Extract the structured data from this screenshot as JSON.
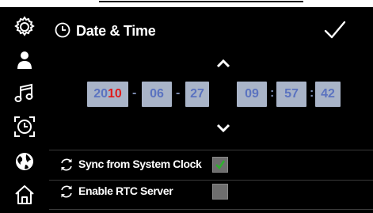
{
  "header": {
    "title": "Date & Time"
  },
  "sidebar": {
    "items": [
      {
        "name": "settings",
        "icon": "gear-icon"
      },
      {
        "name": "user",
        "icon": "user-icon"
      },
      {
        "name": "music",
        "icon": "music-note-icon"
      },
      {
        "name": "clock",
        "icon": "clock-icon",
        "selected": true
      },
      {
        "name": "globe",
        "icon": "globe-icon"
      },
      {
        "name": "home",
        "icon": "home-icon"
      }
    ]
  },
  "datetime": {
    "year_prefix": "20",
    "year_suffix": "10",
    "month": "06",
    "day": "27",
    "hour": "09",
    "minute": "57",
    "second": "42",
    "date_separator": "-",
    "time_separator": ":"
  },
  "options": [
    {
      "label": "Sync from System Clock",
      "checked": true
    },
    {
      "label": "Enable RTC Server",
      "checked": false
    }
  ],
  "colors": {
    "field_bg": "#a9b4c8",
    "field_text": "#5b73c0",
    "year_highlight": "#e11b1b",
    "checked": "#2fb02f"
  }
}
